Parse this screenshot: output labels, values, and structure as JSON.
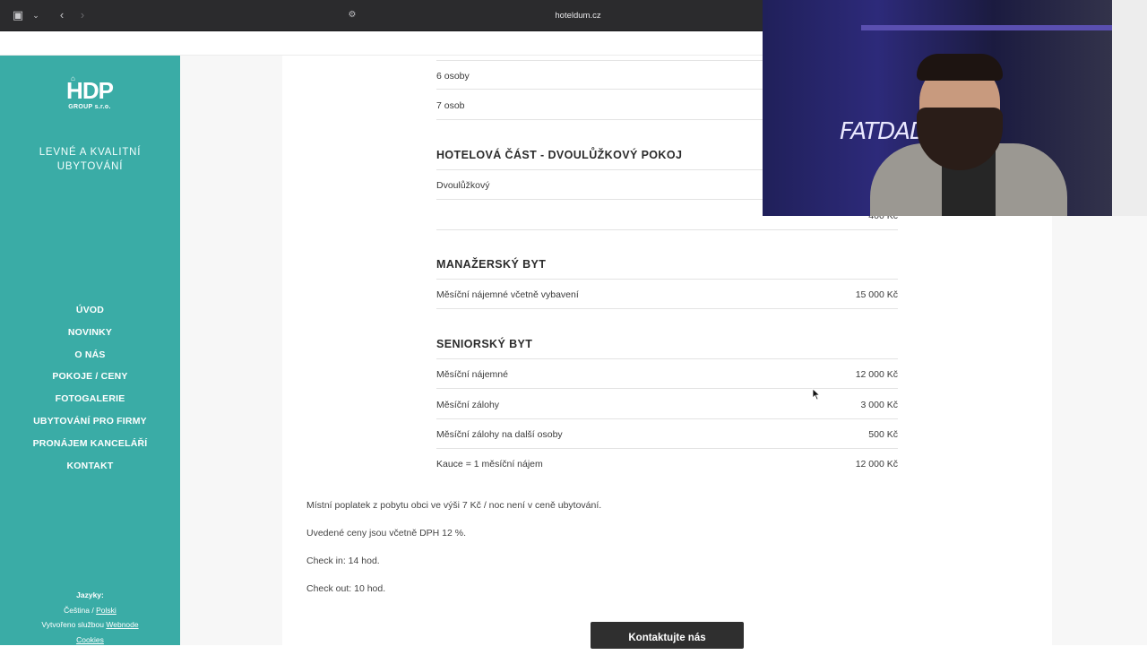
{
  "browser": {
    "url": "hoteldum.cz"
  },
  "sidebar": {
    "logo_text": "HDP",
    "logo_sub": "GROUP s.r.o.",
    "tagline": "LEVNÉ A KVALITNÍ UBYTOVÁNÍ",
    "nav": [
      {
        "label": "ÚVOD"
      },
      {
        "label": "NOVINKY"
      },
      {
        "label": "O NÁS"
      },
      {
        "label": "POKOJE / CENY"
      },
      {
        "label": "FOTOGALERIE"
      },
      {
        "label": "UBYTOVÁNÍ PRO FIRMY"
      },
      {
        "label": "PRONÁJEM KANCELÁŘÍ"
      },
      {
        "label": "KONTAKT"
      }
    ],
    "footer": {
      "languages_label": "Jazyky:",
      "lang_current": "Čeština",
      "lang_sep": "/",
      "lang_other": "Polski",
      "created_by": "Vytvořeno službou",
      "created_link": "Webnode",
      "cookies": "Cookies"
    }
  },
  "pricing": {
    "top_rows": [
      {
        "label": "6 osoby",
        "value": ""
      },
      {
        "label": "7 osob",
        "value": ""
      }
    ],
    "hotel": {
      "heading": "HOTELOVÁ ČÁST - DVOULŮŽKOVÝ POKOJ",
      "rows": [
        {
          "label": "Dvoulůžkový",
          "value": ""
        },
        {
          "label": "",
          "value": "400 Kč"
        }
      ]
    },
    "manager": {
      "heading": "MANAŽERSKÝ BYT",
      "rows": [
        {
          "label": "Měsíční nájemné včetně vybavení",
          "value": "15 000 Kč"
        }
      ]
    },
    "senior": {
      "heading": "SENIORSKÝ BYT",
      "rows": [
        {
          "label": "Měsíční nájemné",
          "value": "12 000 Kč"
        },
        {
          "label": "Měsíční zálohy",
          "value": "3 000 Kč"
        },
        {
          "label": "Měsíční zálohy na další osoby",
          "value": "500 Kč"
        },
        {
          "label": "Kauce = 1 měsíční nájem",
          "value": "12 000 Kč"
        }
      ]
    }
  },
  "notes": [
    "Místní poplatek z pobytu obci ve výši 7 Kč / noc není v ceně ubytování.",
    "Uvedené ceny jsou včetně DPH 12 %.",
    "Check in: 14 hod.",
    "Check out: 10 hod."
  ],
  "cta": {
    "label": "Kontaktujte nás"
  },
  "webcam": {
    "neon_text": "FATDAD"
  }
}
